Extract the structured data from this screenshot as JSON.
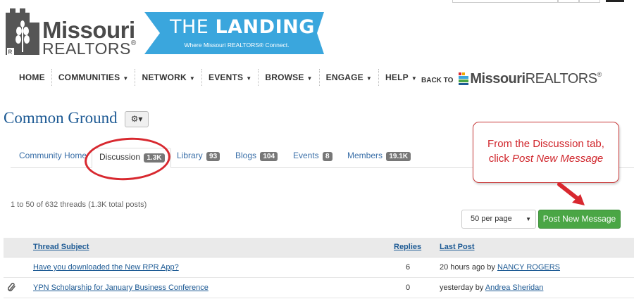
{
  "brand": {
    "logo_line1": "Missouri",
    "logo_line2": "REALTORS",
    "registered": "®",
    "banner_title_light": "THE",
    "banner_title_bold": "LANDING",
    "banner_subtitle": "Where Missouri REALTORS® Connect.",
    "banner_color": "#3aa6dd"
  },
  "nav": {
    "items": [
      {
        "label": "HOME",
        "has_caret": false
      },
      {
        "label": "COMMUNITIES",
        "has_caret": true
      },
      {
        "label": "NETWORK",
        "has_caret": true
      },
      {
        "label": "EVENTS",
        "has_caret": true
      },
      {
        "label": "BROWSE",
        "has_caret": true
      },
      {
        "label": "ENGAGE",
        "has_caret": true
      },
      {
        "label": "HELP",
        "has_caret": true
      }
    ],
    "caret": "▼",
    "back_label": "BACK TO",
    "back_logo_bold": "Missouri",
    "back_logo_light": "REALTORS",
    "back_registered": "®"
  },
  "page": {
    "title": "Common Ground",
    "gear": "⚙▾"
  },
  "tabs": [
    {
      "label": "Community Home",
      "badge": ""
    },
    {
      "label": "Discussion",
      "badge": "1.3K",
      "active": true
    },
    {
      "label": "Library",
      "badge": "93"
    },
    {
      "label": "Blogs",
      "badge": "104"
    },
    {
      "label": "Events",
      "badge": "8"
    },
    {
      "label": "Members",
      "badge": "19.1K"
    }
  ],
  "callout": {
    "line1": "From the Discussion tab,",
    "line2_prefix": "click ",
    "line2_italic": "Post New Message",
    "color": "#d0262c"
  },
  "threads": {
    "summary": "1 to 50 of 632 threads (1.3K total posts)",
    "per_page": "50 per page",
    "post_button": "Post New Message",
    "columns": {
      "subject": "Thread Subject",
      "replies": "Replies",
      "last_post": "Last Post"
    },
    "rows": [
      {
        "subject": "Have you downloaded the New RPR App?",
        "replies": "6",
        "when": "20 hours ago",
        "by": "by",
        "author": "NANCY ROGERS",
        "attachment": false
      },
      {
        "subject": "YPN Scholarship for January Business Conference",
        "replies": "0",
        "when": "yesterday",
        "by": "by",
        "author": "Andrea Sheridan",
        "attachment": true
      }
    ]
  }
}
